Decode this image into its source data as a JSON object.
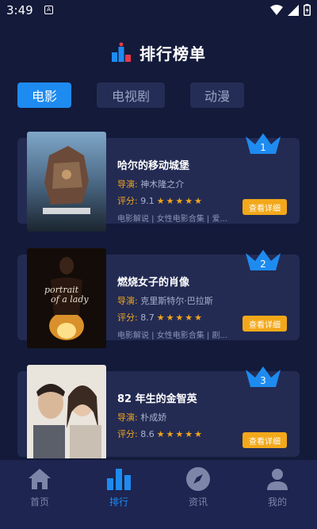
{
  "status_bar": {
    "time": "3:49"
  },
  "header": {
    "title": "排行榜单"
  },
  "tabs": [
    {
      "label": "电影",
      "active": true
    },
    {
      "label": "电视剧",
      "active": false
    },
    {
      "label": "动漫",
      "active": false
    }
  ],
  "movies": [
    {
      "rank": "1",
      "title": "哈尔的移动城堡",
      "director_label": "导演:",
      "director": "神木隆之介",
      "score_label": "评分:",
      "score": "9.1",
      "stars": "★★★★★",
      "tags": "电影解说 | 女性电影合集 | 爱...",
      "button": "查看详细"
    },
    {
      "rank": "2",
      "title": "燃烧女子的肖像",
      "director_label": "导演:",
      "director": "克里斯特尔·巴拉斯",
      "score_label": "评分:",
      "score": "8.7",
      "stars": "★★★★★",
      "tags": "电影解说 | 女性电影合集 | 剧...",
      "button": "查看详细"
    },
    {
      "rank": "3",
      "title": "82 年生的金智英",
      "director_label": "导演:",
      "director": "朴成娇",
      "score_label": "评分:",
      "score": "8.6",
      "stars": "★★★★★",
      "tags": "",
      "button": "查看详细"
    }
  ],
  "bottom_nav": [
    {
      "label": "首页",
      "icon": "home-icon",
      "active": false
    },
    {
      "label": "排行",
      "icon": "ranking-icon",
      "active": true
    },
    {
      "label": "资讯",
      "icon": "compass-icon",
      "active": false
    },
    {
      "label": "我的",
      "icon": "user-icon",
      "active": false
    }
  ],
  "colors": {
    "background": "#131a3a",
    "card": "#232b53",
    "accent_blue": "#1e8bf0",
    "accent_orange": "#f3a81a"
  }
}
